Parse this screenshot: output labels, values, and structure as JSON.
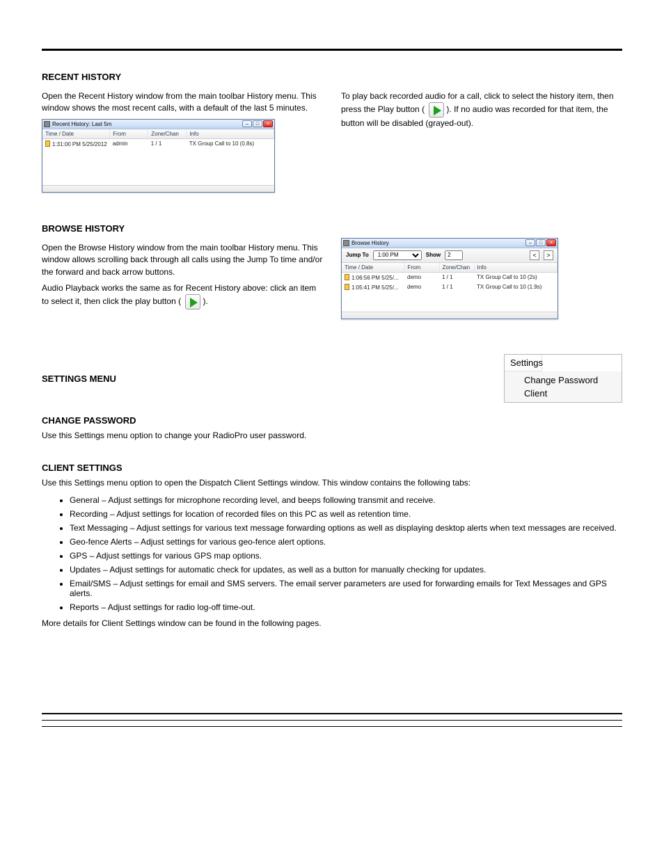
{
  "recent_history": {
    "section_heading": "RECENT HISTORY",
    "intro": "Open the Recent History window from the main toolbar History menu. This window shows the most recent calls, with a default of the last 5 minutes.",
    "window_title": "Recent History: Last 5m",
    "columns": [
      "Time / Date",
      "From",
      "Zone/Chan",
      "Info"
    ],
    "rows": [
      {
        "time": "1:31:00 PM 5/25/2012",
        "from": "admin",
        "zone": "1 / 1",
        "info": "TX Group Call to 10   (0.8s)"
      }
    ],
    "playback_text_1": "To play back recorded audio for a call, click to select the history item, then press the Play button (",
    "playback_text_2": "). If no audio was recorded for that item, the button will be disabled (grayed-out)."
  },
  "browse_history": {
    "section_heading": "BROWSE HISTORY",
    "intro": "Open the Browse History window from the main toolbar History menu. This window allows scrolling back through all calls using the Jump To time and/or the forward and back arrow buttons.",
    "tail": "Audio Playback works the same as for Recent History above: click an item to select it, then click the play button (",
    "tail2": ").",
    "window_title": "Browse History",
    "toolbar": {
      "jump_label": "Jump To",
      "jump_value": "1:00 PM",
      "show_label": "Show",
      "show_value": "2"
    },
    "columns": [
      "Time / Date",
      "From",
      "Zone/Chan",
      "Info"
    ],
    "rows": [
      {
        "time": "1:06:56 PM  5/25/...",
        "from": "demo",
        "zone": "1 / 1",
        "info": "TX Group Call to 10   (2s)"
      },
      {
        "time": "1:05:41 PM  5/25/...",
        "from": "demo",
        "zone": "1 / 1",
        "info": "TX Group Call to 10   (1.9s)"
      }
    ]
  },
  "settings_menu": {
    "section_heading": "SETTINGS MENU",
    "head": "Settings",
    "items": [
      "Change Password",
      "Client"
    ],
    "change_pw_heading": "CHANGE PASSWORD",
    "change_pw_text": "Use this Settings menu option to change your RadioPro user password.",
    "client_heading": "CLIENT SETTINGS",
    "client_intro": "Use this Settings menu option to open the Dispatch Client Settings window. This window contains the following tabs:",
    "client_items": [
      "General – Adjust settings for microphone recording level, and beeps following transmit and receive.",
      "Recording – Adjust settings for location of recorded files on this PC as well as retention time.",
      "Text Messaging – Adjust settings for various text message forwarding options as well as displaying desktop alerts when text messages are received.",
      "Geo-fence Alerts – Adjust settings for various geo-fence alert options.",
      "GPS – Adjust settings for various GPS map options.",
      "Updates – Adjust settings for automatic check for updates, as well as a button for manually checking for updates.",
      "Email/SMS – Adjust settings for email and SMS servers. The email server parameters are used for forwarding emails for Text Messages and GPS alerts.",
      "Reports – Adjust settings for radio log-off time-out."
    ],
    "more": "More details for Client Settings window can be found in the following pages."
  }
}
